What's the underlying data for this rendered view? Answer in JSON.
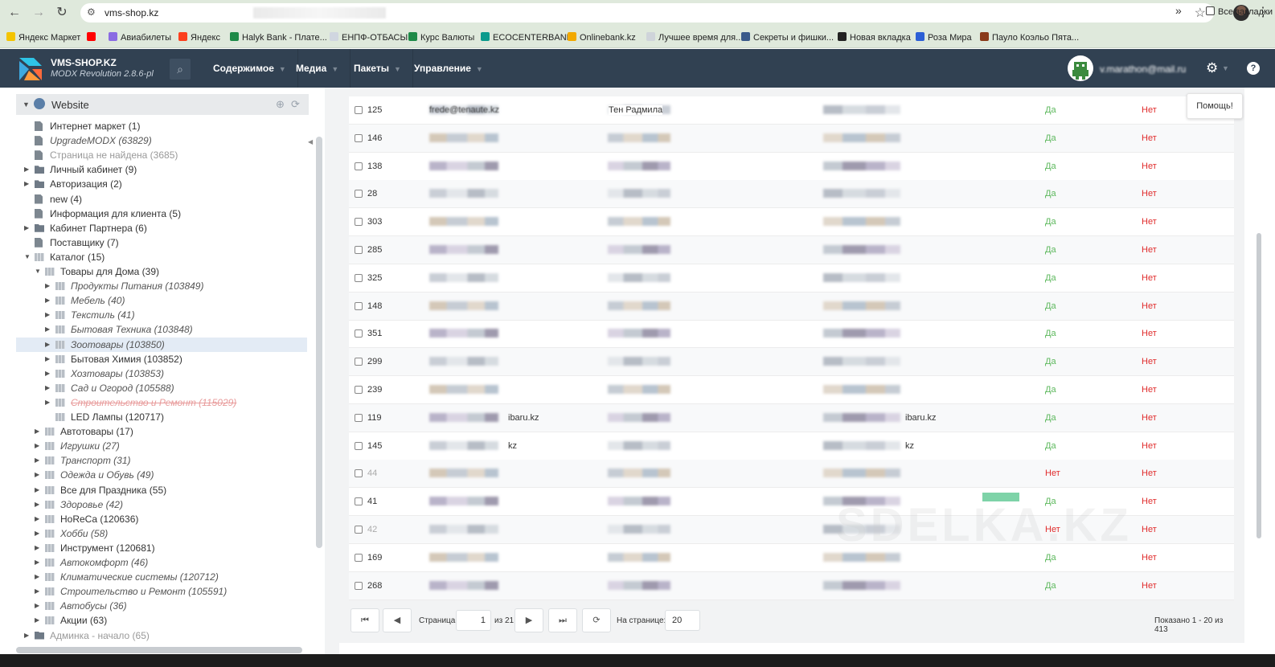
{
  "browser": {
    "url": "vms-shop.kz",
    "bookmarks": [
      {
        "label": "Яндекс Маркет",
        "color": "#f4c400"
      },
      {
        "label": "",
        "color": "#ff0000"
      },
      {
        "label": "Авиабилеты",
        "color": "#8a6be3"
      },
      {
        "label": "Яндекс",
        "color": "#fc3f1d"
      },
      {
        "label": "Halyk Bank - Плате...",
        "color": "#1e8a48"
      },
      {
        "label": "ЕНПФ-ОТБАСЫ",
        "color": "#d0d6e0"
      },
      {
        "label": "Курс Валюты",
        "color": "#1e8a48"
      },
      {
        "label": "ECOCENTERBANK",
        "color": "#0a9a8c"
      },
      {
        "label": "Onlinebank.kz",
        "color": "#f2a900"
      },
      {
        "label": "Лучшее время для...",
        "color": "#cfd4da"
      },
      {
        "label": "Секреты и фишки...",
        "color": "#3a5a8a"
      },
      {
        "label": "Новая вкладка",
        "color": "#222222"
      },
      {
        "label": "Роза Мира",
        "color": "#2c5fd6"
      },
      {
        "label": "Пауло Коэльо Пята...",
        "color": "#8a3a1a"
      }
    ],
    "bookmarks_more": "»",
    "all_bookmarks": "Все закладки"
  },
  "header": {
    "site_name": "VMS-SHOP.KZ",
    "version": "MODX Revolution 2.8.6-pl",
    "menus": [
      "Содержимое",
      "Медиа",
      "Пакеты",
      "Управление"
    ],
    "user_email": "v.marathon@mail.ru",
    "help_button": "Помощь!"
  },
  "tree": {
    "root": "Website",
    "nodes": [
      {
        "label": "Интернет маркет (1)",
        "depth": 0,
        "caret": "",
        "icon": "doc",
        "style": "normal"
      },
      {
        "label": "UpgradeMODX (63829)",
        "depth": 0,
        "caret": "",
        "icon": "doc",
        "style": "ital"
      },
      {
        "label": "Страница не найдена (3685)",
        "depth": 0,
        "caret": "",
        "icon": "doc",
        "style": "gray"
      },
      {
        "label": "Личный кабинет (9)",
        "depth": 0,
        "caret": "▶",
        "icon": "folder",
        "style": "normal"
      },
      {
        "label": "Авторизация (2)",
        "depth": 0,
        "caret": "▶",
        "icon": "folder",
        "style": "normal"
      },
      {
        "label": "new (4)",
        "depth": 0,
        "caret": "",
        "icon": "doc",
        "style": "normal"
      },
      {
        "label": "Информация для клиента (5)",
        "depth": 0,
        "caret": "",
        "icon": "doc",
        "style": "normal"
      },
      {
        "label": "Кабинет Партнера (6)",
        "depth": 0,
        "caret": "▶",
        "icon": "folder",
        "style": "normal"
      },
      {
        "label": "Поставщику (7)",
        "depth": 0,
        "caret": "",
        "icon": "doc",
        "style": "normal"
      },
      {
        "label": "Каталог (15)",
        "depth": 0,
        "caret": "▼",
        "icon": "cat",
        "style": "normal"
      },
      {
        "label": "Товары для Дома (39)",
        "depth": 1,
        "caret": "▼",
        "icon": "cat",
        "style": "normal"
      },
      {
        "label": "Продукты Питания (103849)",
        "depth": 2,
        "caret": "▶",
        "icon": "cat",
        "style": "ital"
      },
      {
        "label": "Мебель (40)",
        "depth": 2,
        "caret": "▶",
        "icon": "cat",
        "style": "ital"
      },
      {
        "label": "Текстиль (41)",
        "depth": 2,
        "caret": "▶",
        "icon": "cat",
        "style": "ital"
      },
      {
        "label": "Бытовая Техника (103848)",
        "depth": 2,
        "caret": "▶",
        "icon": "cat",
        "style": "ital"
      },
      {
        "label": "Зоотовары (103850)",
        "depth": 2,
        "caret": "▶",
        "icon": "cat",
        "style": "ital",
        "selected": true
      },
      {
        "label": "Бытовая Химия (103852)",
        "depth": 2,
        "caret": "▶",
        "icon": "cat",
        "style": "normal"
      },
      {
        "label": "Хозтовары (103853)",
        "depth": 2,
        "caret": "▶",
        "icon": "cat",
        "style": "ital"
      },
      {
        "label": "Сад и Огород (105588)",
        "depth": 2,
        "caret": "▶",
        "icon": "cat",
        "style": "ital"
      },
      {
        "label": "Строительство и Ремонт (115029)",
        "depth": 2,
        "caret": "▶",
        "icon": "cat",
        "style": "red"
      },
      {
        "label": "LED Лампы (120717)",
        "depth": 2,
        "caret": "",
        "icon": "cat",
        "style": "normal"
      },
      {
        "label": "Автотовары (17)",
        "depth": 1,
        "caret": "▶",
        "icon": "cat",
        "style": "normal"
      },
      {
        "label": "Игрушки (27)",
        "depth": 1,
        "caret": "▶",
        "icon": "cat",
        "style": "ital"
      },
      {
        "label": "Транспорт (31)",
        "depth": 1,
        "caret": "▶",
        "icon": "cat",
        "style": "ital"
      },
      {
        "label": "Одежда и Обувь (49)",
        "depth": 1,
        "caret": "▶",
        "icon": "cat",
        "style": "ital"
      },
      {
        "label": "Все для Праздника (55)",
        "depth": 1,
        "caret": "▶",
        "icon": "cat",
        "style": "normal"
      },
      {
        "label": "Здоровье (42)",
        "depth": 1,
        "caret": "▶",
        "icon": "cat",
        "style": "ital"
      },
      {
        "label": "HoReCa (120636)",
        "depth": 1,
        "caret": "▶",
        "icon": "cat",
        "style": "normal"
      },
      {
        "label": "Хобби (58)",
        "depth": 1,
        "caret": "▶",
        "icon": "cat",
        "style": "ital"
      },
      {
        "label": "Инструмент (120681)",
        "depth": 1,
        "caret": "▶",
        "icon": "cat",
        "style": "normal"
      },
      {
        "label": "Автокомфорт (46)",
        "depth": 1,
        "caret": "▶",
        "icon": "cat",
        "style": "ital"
      },
      {
        "label": "Климатические системы (120712)",
        "depth": 1,
        "caret": "▶",
        "icon": "cat",
        "style": "ital"
      },
      {
        "label": "Строительство и Ремонт (105591)",
        "depth": 1,
        "caret": "▶",
        "icon": "cat",
        "style": "ital"
      },
      {
        "label": "Автобусы (36)",
        "depth": 1,
        "caret": "▶",
        "icon": "cat",
        "style": "ital"
      },
      {
        "label": "Акции (63)",
        "depth": 1,
        "caret": "▶",
        "icon": "cat",
        "style": "normal"
      },
      {
        "label": "Админка - начало (65)",
        "depth": 0,
        "caret": "▶",
        "icon": "folder",
        "style": "gray"
      }
    ]
  },
  "grid": {
    "rows": [
      {
        "id": "125",
        "email": "frede@tenaute.kz",
        "name": "Тен Радмила",
        "suffix": "",
        "active": "Да",
        "blocked": "Нет",
        "muted": false
      },
      {
        "id": "146",
        "email": "",
        "name": "",
        "suffix": "",
        "active": "Да",
        "blocked": "Нет",
        "muted": false
      },
      {
        "id": "138",
        "email": "",
        "name": "",
        "suffix": "",
        "active": "Да",
        "blocked": "Нет",
        "muted": false
      },
      {
        "id": "28",
        "email": "",
        "name": "",
        "suffix": "",
        "active": "Да",
        "blocked": "Нет",
        "muted": false
      },
      {
        "id": "303",
        "email": "",
        "name": "",
        "suffix": "",
        "active": "Да",
        "blocked": "Нет",
        "muted": false
      },
      {
        "id": "285",
        "email": "",
        "name": "",
        "suffix": "",
        "active": "Да",
        "blocked": "Нет",
        "muted": false
      },
      {
        "id": "325",
        "email": "",
        "name": "",
        "suffix": "",
        "active": "Да",
        "blocked": "Нет",
        "muted": false
      },
      {
        "id": "148",
        "email": "",
        "name": "",
        "suffix": "",
        "active": "Да",
        "blocked": "Нет",
        "muted": false
      },
      {
        "id": "351",
        "email": "",
        "name": "",
        "suffix": "",
        "active": "Да",
        "blocked": "Нет",
        "muted": false
      },
      {
        "id": "299",
        "email": "",
        "name": "",
        "suffix": "",
        "active": "Да",
        "blocked": "Нет",
        "muted": false
      },
      {
        "id": "239",
        "email": "",
        "name": "",
        "suffix": "",
        "active": "Да",
        "blocked": "Нет",
        "muted": false
      },
      {
        "id": "119",
        "email": "ibaru.kz",
        "name": "",
        "suffix": "ibaru.kz",
        "active": "Да",
        "blocked": "Нет",
        "muted": false
      },
      {
        "id": "145",
        "email": "kz",
        "name": "",
        "suffix": "kz",
        "active": "Да",
        "blocked": "Нет",
        "muted": false
      },
      {
        "id": "44",
        "email": "",
        "name": "",
        "suffix": "",
        "active": "Нет",
        "blocked": "Нет",
        "muted": true
      },
      {
        "id": "41",
        "email": "",
        "name": "",
        "suffix": "",
        "active": "Да",
        "blocked": "Нет",
        "muted": false
      },
      {
        "id": "42",
        "email": "",
        "name": "",
        "suffix": "",
        "active": "Нет",
        "blocked": "Нет",
        "muted": true
      },
      {
        "id": "169",
        "email": "",
        "name": "",
        "suffix": "",
        "active": "Да",
        "blocked": "Нет",
        "muted": false
      },
      {
        "id": "268",
        "email": "",
        "name": "",
        "suffix": "",
        "active": "Да",
        "blocked": "Нет",
        "muted": false
      }
    ],
    "pager": {
      "page_label": "Страница",
      "page_value": "1",
      "of_label": "из 21",
      "per_page_label": "На странице:",
      "per_page_value": "20",
      "shown": "Показано 1 - 20 из 413"
    }
  },
  "watermark": "SDELKA.KZ"
}
